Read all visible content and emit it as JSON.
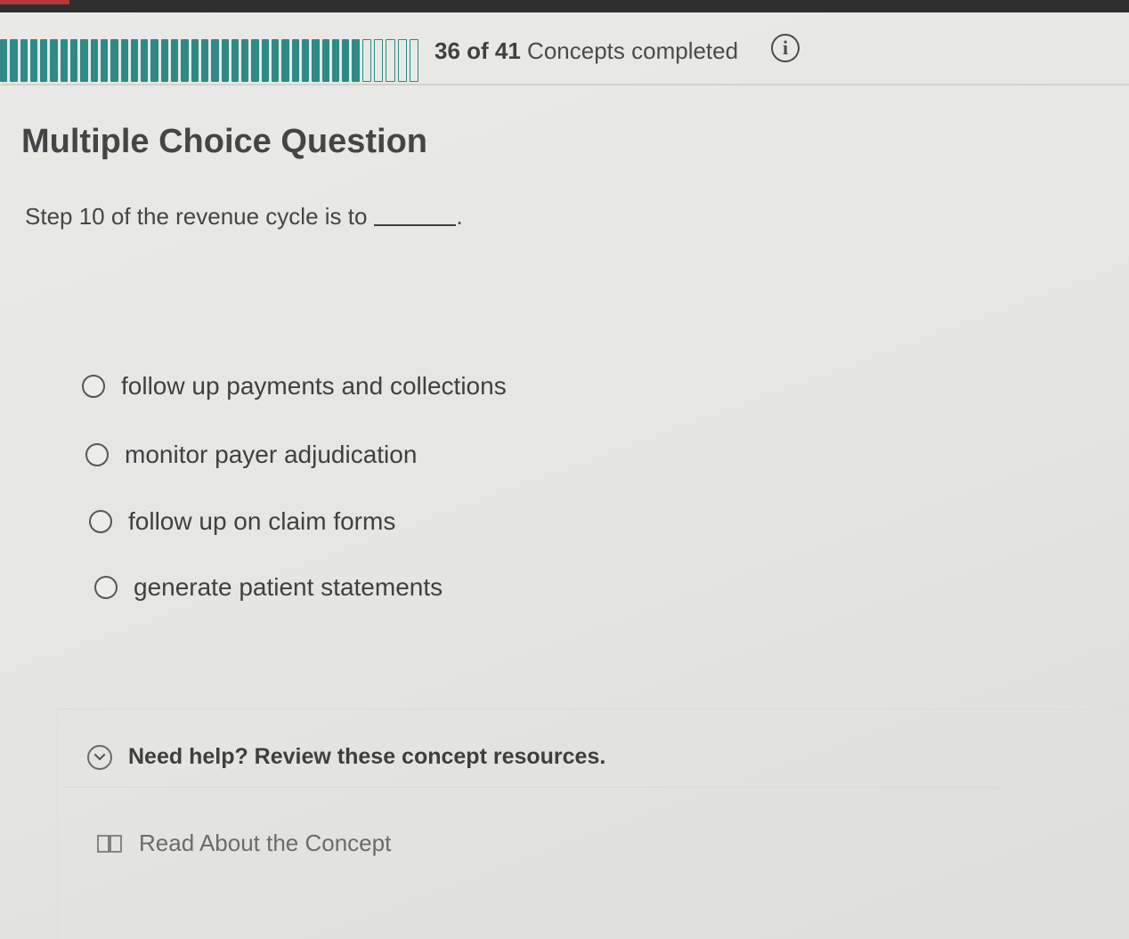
{
  "progress": {
    "completed": 36,
    "total": 41,
    "count_text": "36 of 41",
    "suffix_text": " Concepts completed",
    "info_glyph": "i",
    "bar_color": "#2f8a86"
  },
  "question": {
    "type_title": "Multiple Choice Question",
    "prompt": "Step 10 of the revenue cycle is to",
    "prompt_end": "."
  },
  "options": [
    {
      "label": "follow up payments and collections"
    },
    {
      "label": "monitor payer adjudication"
    },
    {
      "label": "follow up on claim forms"
    },
    {
      "label": "generate patient statements"
    }
  ],
  "help": {
    "toggle_label": "Need help? Review these concept resources.",
    "read_label": "Read About the Concept"
  },
  "icons": {
    "info": "info-icon",
    "toggle": "chevron-down-icon",
    "read": "book-icon"
  }
}
